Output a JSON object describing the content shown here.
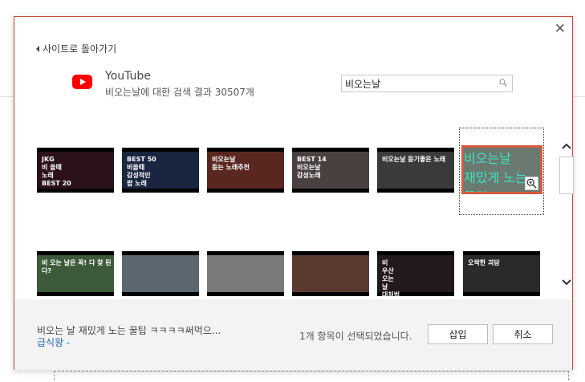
{
  "back_link": "사이트로 돌아가기",
  "provider": {
    "name": "YouTube",
    "result_text": "비오는날에 대한 검색 결과 30507개"
  },
  "search": {
    "value": "비오는날"
  },
  "thumbnails_row1": [
    {
      "lines": [
        "JKG",
        "비 올때",
        "노래",
        "BEST 20"
      ],
      "bg": "#2a1218"
    },
    {
      "lines": [
        "BEST 50",
        "비올때",
        "감성적인",
        "팝 노래"
      ],
      "bg": "#1a2540"
    },
    {
      "lines": [
        "비오는날",
        "듣는 노래추천"
      ],
      "bg": "#5a2620"
    },
    {
      "lines": [
        "BEST 14",
        "비오는날",
        "감성노래"
      ],
      "bg": "#4a4040"
    },
    {
      "lines": [
        "비오는날 듣기좋은 노래"
      ],
      "bg": "#3a3a3a"
    },
    {
      "lines": [
        "비오는날",
        "재밌게 노는 꿀팁"
      ],
      "bg": "#6a7a70",
      "selected": true
    }
  ],
  "thumbnails_row2": [
    {
      "lines": [
        "비 오는 날은 꼭! 다 찾 된다?"
      ],
      "bg": "#3d5a3a"
    },
    {
      "lines": [
        ""
      ],
      "bg": "#5a6670"
    },
    {
      "lines": [
        ""
      ],
      "bg": "#7a7a7a"
    },
    {
      "lines": [
        ""
      ],
      "bg": "#5a3a30"
    },
    {
      "lines": [
        "비",
        "우산",
        "오는",
        "날",
        "대처법"
      ],
      "bg": "#221a1a"
    },
    {
      "lines": [
        "오싹한 괴담"
      ],
      "bg": "#2a2a2a"
    }
  ],
  "footer": {
    "video_title": "비오는 날 재밌게 노는 꿀팁 ㅋㅋㅋㅋ써먹으...",
    "channel": "급식왕 -",
    "status": "1개 항목이 선택되었습니다.",
    "insert_label": "삽입",
    "cancel_label": "취소"
  },
  "colors": {
    "accent": "#d65a3c",
    "youtube_red": "#ff0000",
    "link": "#2b66b8"
  }
}
